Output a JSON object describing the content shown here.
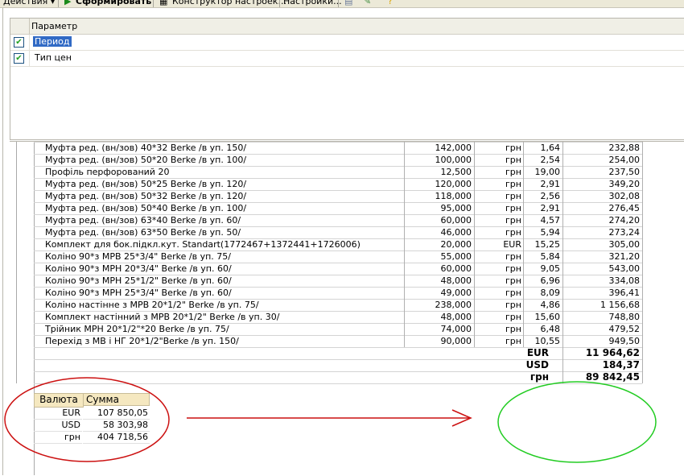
{
  "toolbar": {
    "actions_label": "Действия ▾",
    "generate_label": "Сформировать",
    "constructor_label": "Конструктор настроек...",
    "settings_label": "Настройки..."
  },
  "params": {
    "header": "Параметр",
    "rows": [
      {
        "label": "Период",
        "checked": true,
        "selected": true
      },
      {
        "label": "Тип цен",
        "checked": true,
        "selected": false
      }
    ]
  },
  "table": {
    "rows": [
      {
        "name": "Муфта ред. (вн/зов) 40*32 Berke /в уп. 150/",
        "qty": "142,000",
        "cur": "грн",
        "price": "1,64",
        "sum": "232,88"
      },
      {
        "name": "Муфта ред. (вн/зов) 50*20 Berke /в уп. 100/",
        "qty": "100,000",
        "cur": "грн",
        "price": "2,54",
        "sum": "254,00"
      },
      {
        "name": "Профіль перфорований 20",
        "qty": "12,500",
        "cur": "грн",
        "price": "19,00",
        "sum": "237,50"
      },
      {
        "name": "Муфта ред. (вн/зов) 50*25 Berke /в уп. 120/",
        "qty": "120,000",
        "cur": "грн",
        "price": "2,91",
        "sum": "349,20"
      },
      {
        "name": "Муфта ред. (вн/зов) 50*32 Berke /в уп. 120/",
        "qty": "118,000",
        "cur": "грн",
        "price": "2,56",
        "sum": "302,08"
      },
      {
        "name": "Муфта ред. (вн/зов) 50*40 Berke /в уп. 100/",
        "qty": "95,000",
        "cur": "грн",
        "price": "2,91",
        "sum": "276,45"
      },
      {
        "name": "Муфта ред. (вн/зов) 63*40 Berke /в уп. 60/",
        "qty": "60,000",
        "cur": "грн",
        "price": "4,57",
        "sum": "274,20"
      },
      {
        "name": "Муфта ред. (вн/зов) 63*50 Berke /в уп. 50/",
        "qty": "46,000",
        "cur": "грн",
        "price": "5,94",
        "sum": "273,24"
      },
      {
        "name": "Комплект для бок.підкл.кут. Standart(1772467+1372441+1726006)",
        "qty": "20,000",
        "cur": "EUR",
        "price": "15,25",
        "sum": "305,00"
      },
      {
        "name": "Коліно 90*з МРВ 25*3/4\" Berke /в уп. 75/",
        "qty": "55,000",
        "cur": "грн",
        "price": "5,84",
        "sum": "321,20"
      },
      {
        "name": "Коліно 90*з МРН 20*3/4\" Berke /в уп. 60/",
        "qty": "60,000",
        "cur": "грн",
        "price": "9,05",
        "sum": "543,00"
      },
      {
        "name": "Коліно 90*з МРН 25*1/2\" Berke /в уп. 60/",
        "qty": "48,000",
        "cur": "грн",
        "price": "6,96",
        "sum": "334,08"
      },
      {
        "name": "Коліно 90*з МРН 25*3/4\" Berke /в уп. 60/",
        "qty": "49,000",
        "cur": "грн",
        "price": "8,09",
        "sum": "396,41"
      },
      {
        "name": "Коліно настінне з МРВ 20*1/2\" Berke /в уп. 75/",
        "qty": "238,000",
        "cur": "грн",
        "price": "4,86",
        "sum": "1 156,68"
      },
      {
        "name": "Комплект настінний з МРВ 20*1/2\" Berke /в уп. 30/",
        "qty": "48,000",
        "cur": "грн",
        "price": "15,60",
        "sum": "748,80"
      },
      {
        "name": "Трійник МРН 20*1/2\"*20 Berke /в уп. 75/",
        "qty": "74,000",
        "cur": "грн",
        "price": "6,48",
        "sum": "479,52"
      },
      {
        "name": "Перехід з МВ і НГ 20*1/2\"Berke /в уп. 150/",
        "qty": "90,000",
        "cur": "грн",
        "price": "10,55",
        "sum": "949,50"
      }
    ],
    "totals": [
      {
        "cur": "EUR",
        "sum": "11 964,62"
      },
      {
        "cur": "USD",
        "sum": "184,37"
      },
      {
        "cur": "грн",
        "sum": "89 842,45"
      }
    ]
  },
  "currency_summary": {
    "headers": [
      "Валюта",
      "Сумма"
    ],
    "rows": [
      {
        "cur": "EUR",
        "sum": "107 850,05"
      },
      {
        "cur": "USD",
        "sum": "58 303,98"
      },
      {
        "cur": "грн",
        "sum": "404 718,56"
      }
    ]
  },
  "annotation_colors": {
    "red": "#cc1111",
    "green": "#22cc22"
  }
}
